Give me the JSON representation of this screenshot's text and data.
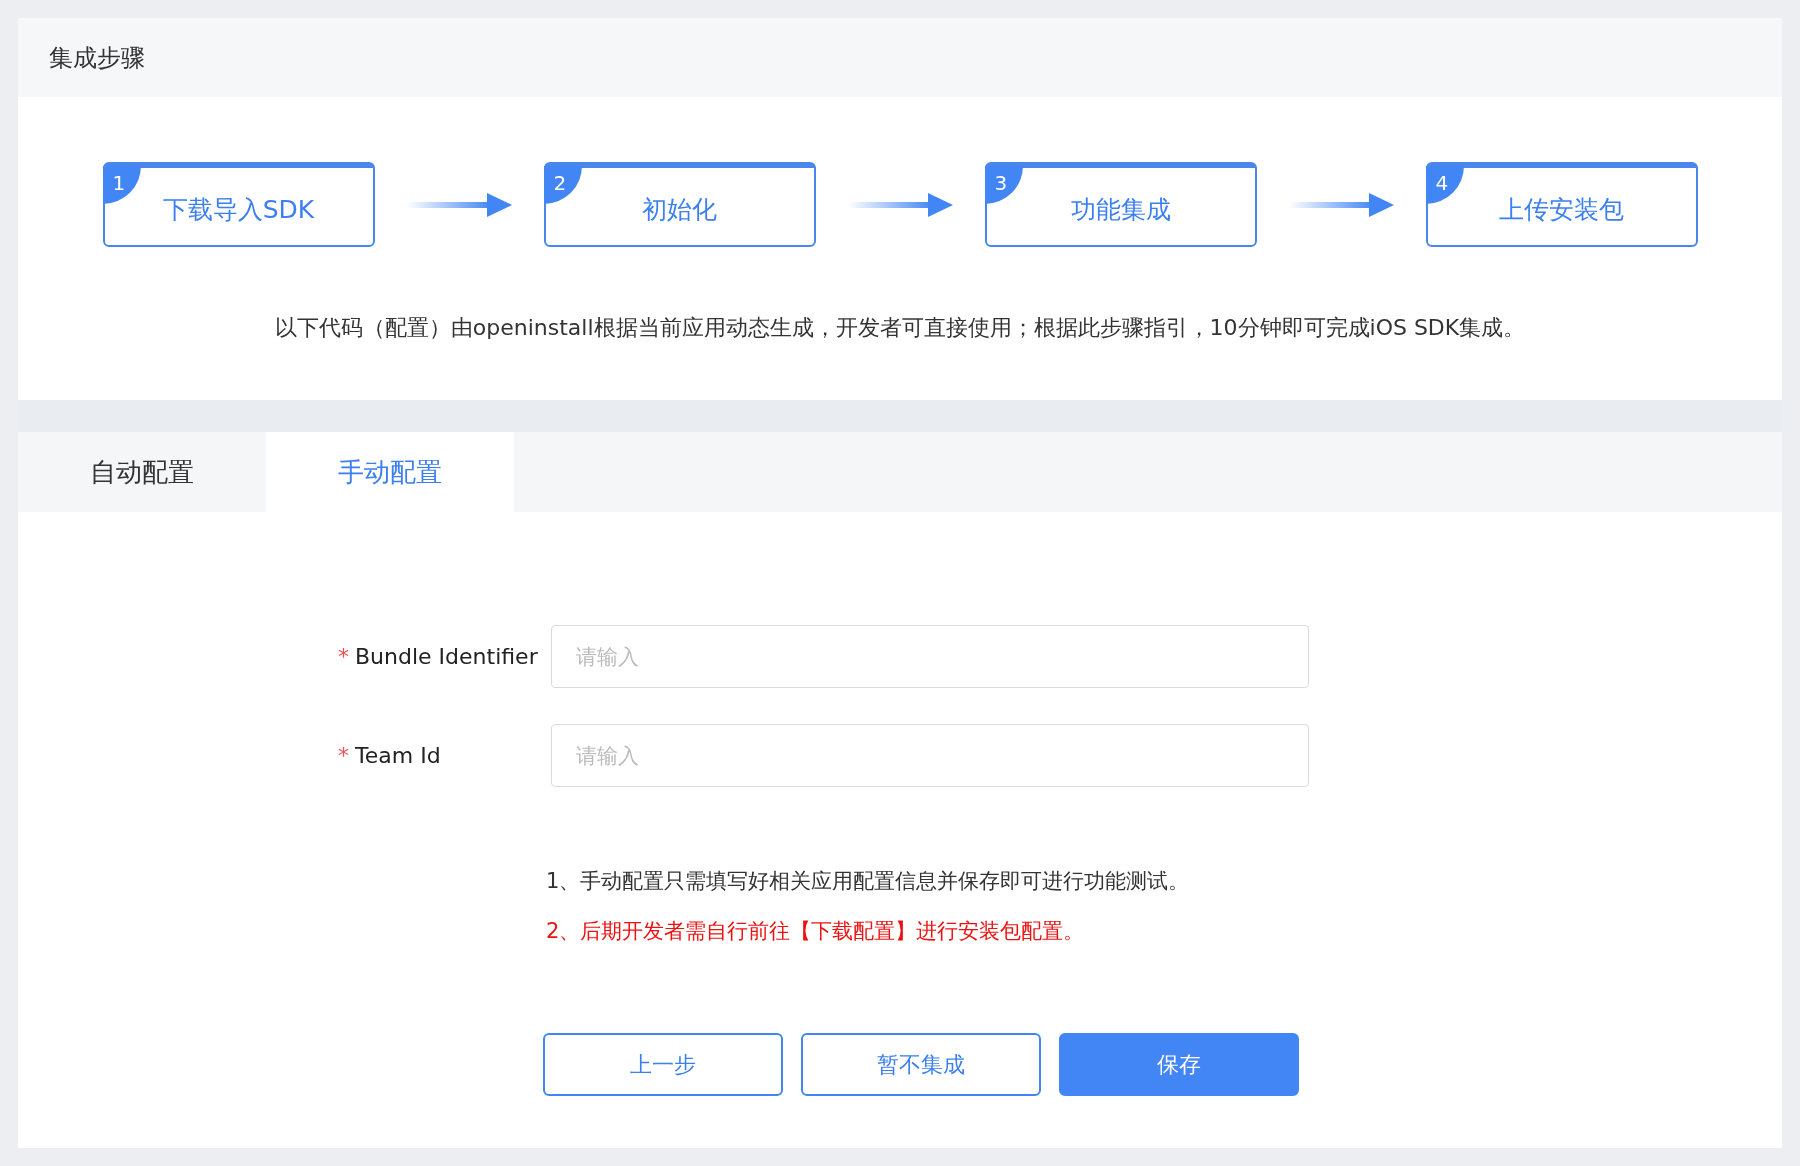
{
  "header": {
    "title": "集成步骤"
  },
  "steps": [
    {
      "number": "1",
      "label": "下载导入SDK"
    },
    {
      "number": "2",
      "label": "初始化"
    },
    {
      "number": "3",
      "label": "功能集成"
    },
    {
      "number": "4",
      "label": "上传安装包"
    }
  ],
  "description": "以下代码（配置）由openinstall根据当前应用动态生成，开发者可直接使用；根据此步骤指引，10分钟即可完成iOS SDK集成。",
  "tabs": [
    {
      "label": "自动配置",
      "selected": false
    },
    {
      "label": "手动配置",
      "selected": true
    }
  ],
  "form": {
    "fields": [
      {
        "label": "Bundle Identifier",
        "required": true,
        "required_mark": "*",
        "placeholder": "请输入"
      },
      {
        "label": "Team Id",
        "required": true,
        "required_mark": "*",
        "placeholder": "请输入"
      }
    ]
  },
  "notes": [
    {
      "text": "1、手动配置只需填写好相关应用配置信息并保存即可进行功能测试。",
      "kind": "normal"
    },
    {
      "text": "2、后期开发者需自行前往【下载配置】进行安装包配置。",
      "kind": "warning"
    }
  ],
  "buttons": [
    {
      "label": "上一步",
      "kind": "outline"
    },
    {
      "label": "暂不集成",
      "kind": "outline"
    },
    {
      "label": "保存",
      "kind": "primary"
    }
  ]
}
